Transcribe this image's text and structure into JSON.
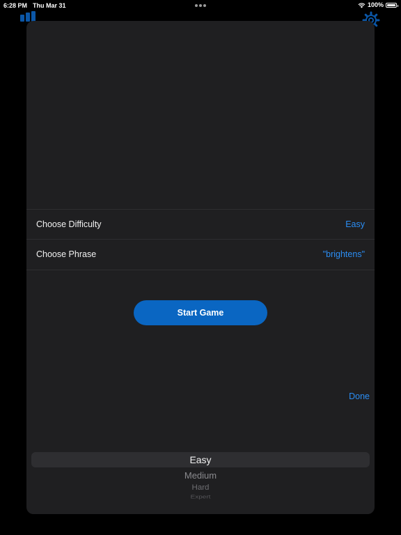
{
  "status_bar": {
    "time": "6:28 PM",
    "date": "Thu Mar 31",
    "battery": "100%",
    "battery_level": 1.0
  },
  "settings": {
    "difficulty": {
      "label": "Choose Difficulty",
      "value": "Easy"
    },
    "phrase": {
      "label": "Choose Phrase",
      "value": "\"brightens\""
    }
  },
  "start_button_label": "Start Game",
  "done_label": "Done",
  "picker": {
    "selected": "Easy",
    "options": [
      "Easy",
      "Medium",
      "Hard",
      "Expert"
    ]
  },
  "colors": {
    "accent": "#2b8ef5",
    "button": "#0a66c2",
    "sheet_bg": "#1f1f21"
  },
  "icons": [
    "wifi-icon",
    "battery-icon",
    "bars-icon",
    "gear-icon"
  ]
}
